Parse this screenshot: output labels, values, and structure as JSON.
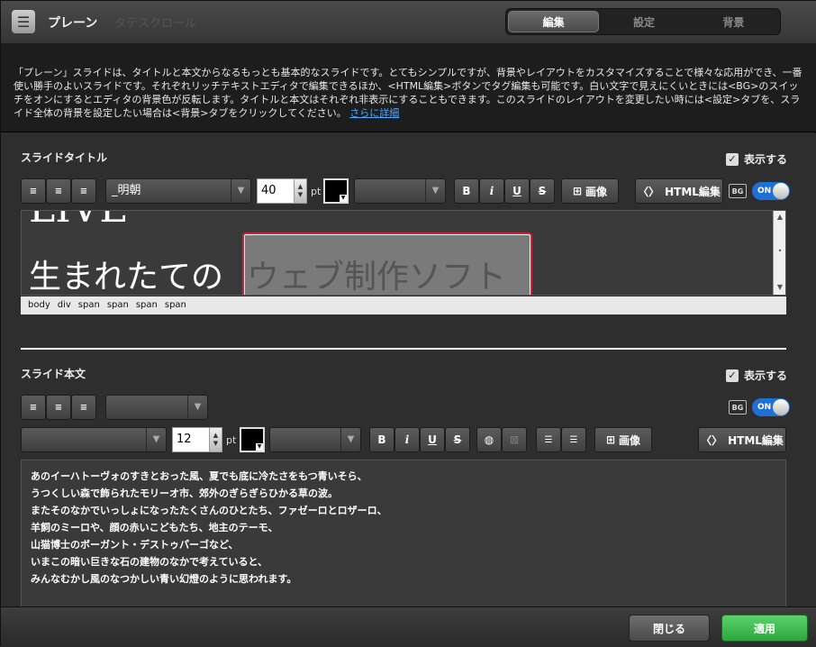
{
  "header": {
    "title": "プレーン",
    "ghost_text": "タテスクロール",
    "tabs": [
      {
        "label": "編集",
        "active": true
      },
      {
        "label": "設定",
        "active": false
      },
      {
        "label": "背景",
        "active": false
      }
    ]
  },
  "description": {
    "text": "「プレーン」スライドは、タイトルと本文からなるもっとも基本的なスライドです。とてもシンプルですが、背景やレイアウトをカスタマイズすることで様々な応用ができ、一番使い勝手のよいスライドです。それぞれリッチテキストエディタで編集できるほか、<HTML編集>ボタンでタグ編集も可能です。白い文字で見えにくいときには<BG>のスイッチをオンにするとエディタの背景色が反転します。タイトルと本文はそれぞれ非表示にすることもできます。このスライドのレイアウトを変更したい時には<設定>タブを、スライド全体の背景を設定したい場合は<背景>タブをクリックしてください。",
    "link": "さらに詳細"
  },
  "title_section": {
    "heading": "スライドタイトル",
    "show_label": "表示する",
    "font": "_明朝",
    "size": "40",
    "unit": "pt",
    "image_label": "画像",
    "html_label": "HTML編集",
    "bg_label": "BG",
    "toggle_label": "ON",
    "content_top": "LIVE",
    "content_line": "生まれたての",
    "content_selected": "ウェブ制作ソフト",
    "path": [
      "body",
      "div",
      "span",
      "span",
      "span",
      "span"
    ]
  },
  "body_section": {
    "heading": "スライド本文",
    "show_label": "表示する",
    "size": "12",
    "unit": "pt",
    "image_label": "画像",
    "html_label": "HTML編集",
    "bg_label": "BG",
    "toggle_label": "ON",
    "lines": [
      "あのイーハトーヴォのすきとおった風、夏でも底に冷たさをもつ青いそら、",
      "うつくしい森で飾られたモリーオ市、郊外のぎらぎらひかる草の波。",
      "またそのなかでいっしょになったたくさんのひとたち、ファゼーロとロザーロ、",
      "羊飼のミーロや、顔の赤いこどもたち、地主のテーモ、",
      "山猫博士のボーガント・デストゥパーゴなど、",
      "いまこの暗い巨きな石の建物のなかで考えていると、",
      "みんなむかし風のなつかしい青い幻燈のように思われます。"
    ]
  },
  "footer": {
    "close_label": "閉じる",
    "apply_label": "適用"
  },
  "colors": {
    "accent": "#1e6fd6",
    "apply": "#3fbf50",
    "selection_border": "#d0213a"
  }
}
